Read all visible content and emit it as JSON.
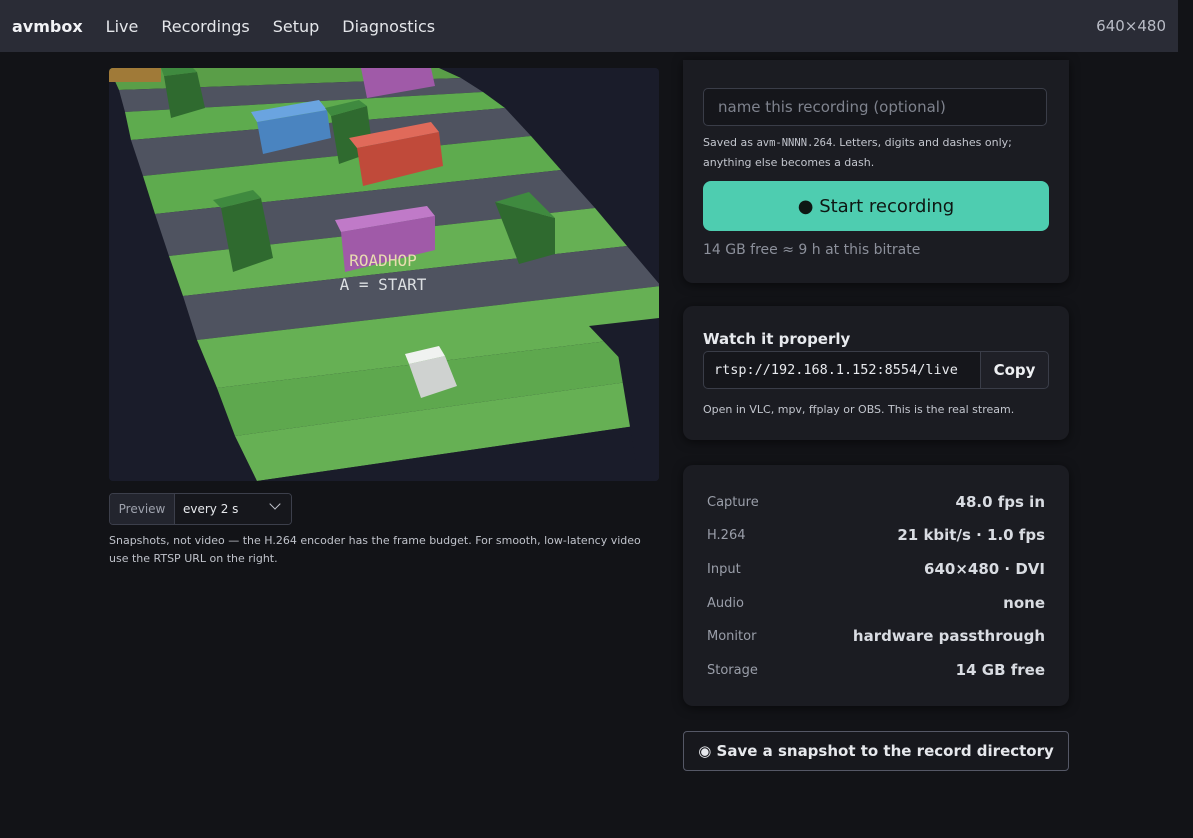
{
  "nav": {
    "brand": "avmbox",
    "links": [
      "Live",
      "Recordings",
      "Setup",
      "Diagnostics"
    ],
    "resolution": "640×480"
  },
  "preview": {
    "game_title": "ROADHOP",
    "game_prompt": "A = START",
    "mode_label": "Preview",
    "interval": "every 2 s",
    "note": "Snapshots, not video — the H.264 encoder has the frame budget. For smooth, low-latency video use the RTSP URL on the right."
  },
  "recording": {
    "name_placeholder": "name this recording (optional)",
    "hint_prefix": "Saved as ",
    "hint_filename": "avm-NNNN.264",
    "hint_suffix": ". Letters, digits and dashes only; anything else becomes a dash.",
    "start_label": "● Start recording",
    "free_text": "14 GB free ≈ 9 h at this bitrate",
    "accent": "#4ecdb0"
  },
  "watch": {
    "title": "Watch it properly",
    "url": "rtsp://192.168.1.152:8554/live",
    "copy_label": "Copy",
    "note": "Open in VLC, mpv, ffplay or OBS. This is the real stream."
  },
  "stats": [
    {
      "key": "Capture",
      "value": "48.0 fps in"
    },
    {
      "key": "H.264",
      "value": "21 kbit/s · 1.0 fps"
    },
    {
      "key": "Input",
      "value": "640×480 · DVI"
    },
    {
      "key": "Audio",
      "value": "none"
    },
    {
      "key": "Monitor",
      "value": "hardware passthrough"
    },
    {
      "key": "Storage",
      "value": "14 GB free"
    }
  ],
  "snapshot_label": "◉ Save a snapshot to the record directory"
}
